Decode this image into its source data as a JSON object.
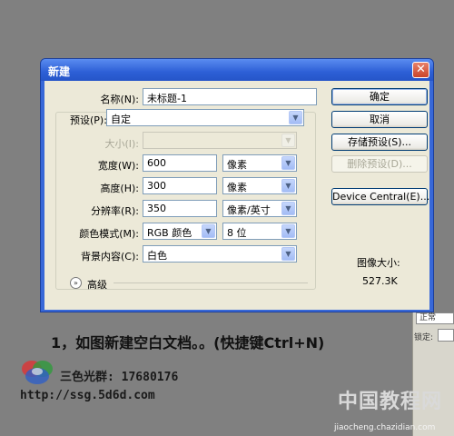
{
  "dialog": {
    "title": "新建",
    "close_glyph": "✕",
    "fields": {
      "name": {
        "label": "名称(N):",
        "value": "未标题-1"
      },
      "preset": {
        "label": "预设(P):",
        "value": "自定"
      },
      "size": {
        "label": "大小(I):",
        "value": ""
      },
      "width": {
        "label": "宽度(W):",
        "value": "600",
        "unit": "像素"
      },
      "height": {
        "label": "高度(H):",
        "value": "300",
        "unit": "像素"
      },
      "resolution": {
        "label": "分辨率(R):",
        "value": "350",
        "unit": "像素/英寸"
      },
      "color_mode": {
        "label": "颜色模式(M):",
        "value": "RGB 颜色",
        "bits": "8 位"
      },
      "background": {
        "label": "背景内容(C):",
        "value": "白色"
      }
    },
    "advanced_label": "高级",
    "buttons": {
      "ok": "确定",
      "cancel": "取消",
      "save_preset": "存储预设(S)...",
      "delete_preset": "删除预设(D)...",
      "device_central": "Device Central(E)..."
    },
    "image_size_label": "图像大小:",
    "image_size_value": "527.3K"
  },
  "annotation": {
    "caption": "1，如图新建空白文档。。(快捷键Ctrl+N)",
    "group": "三色光群: 17680176",
    "url": "http://ssg.5d6d.com"
  },
  "background_panel": {
    "field_text": "正常",
    "lock_label": "锁定:"
  },
  "watermark": {
    "cn": "中国教程网",
    "en": "jiaocheng.chazidian.com"
  },
  "colors": {
    "titlebar": "#2d5fd6",
    "dialog_body": "#ece9d8",
    "desktop": "#808080"
  }
}
